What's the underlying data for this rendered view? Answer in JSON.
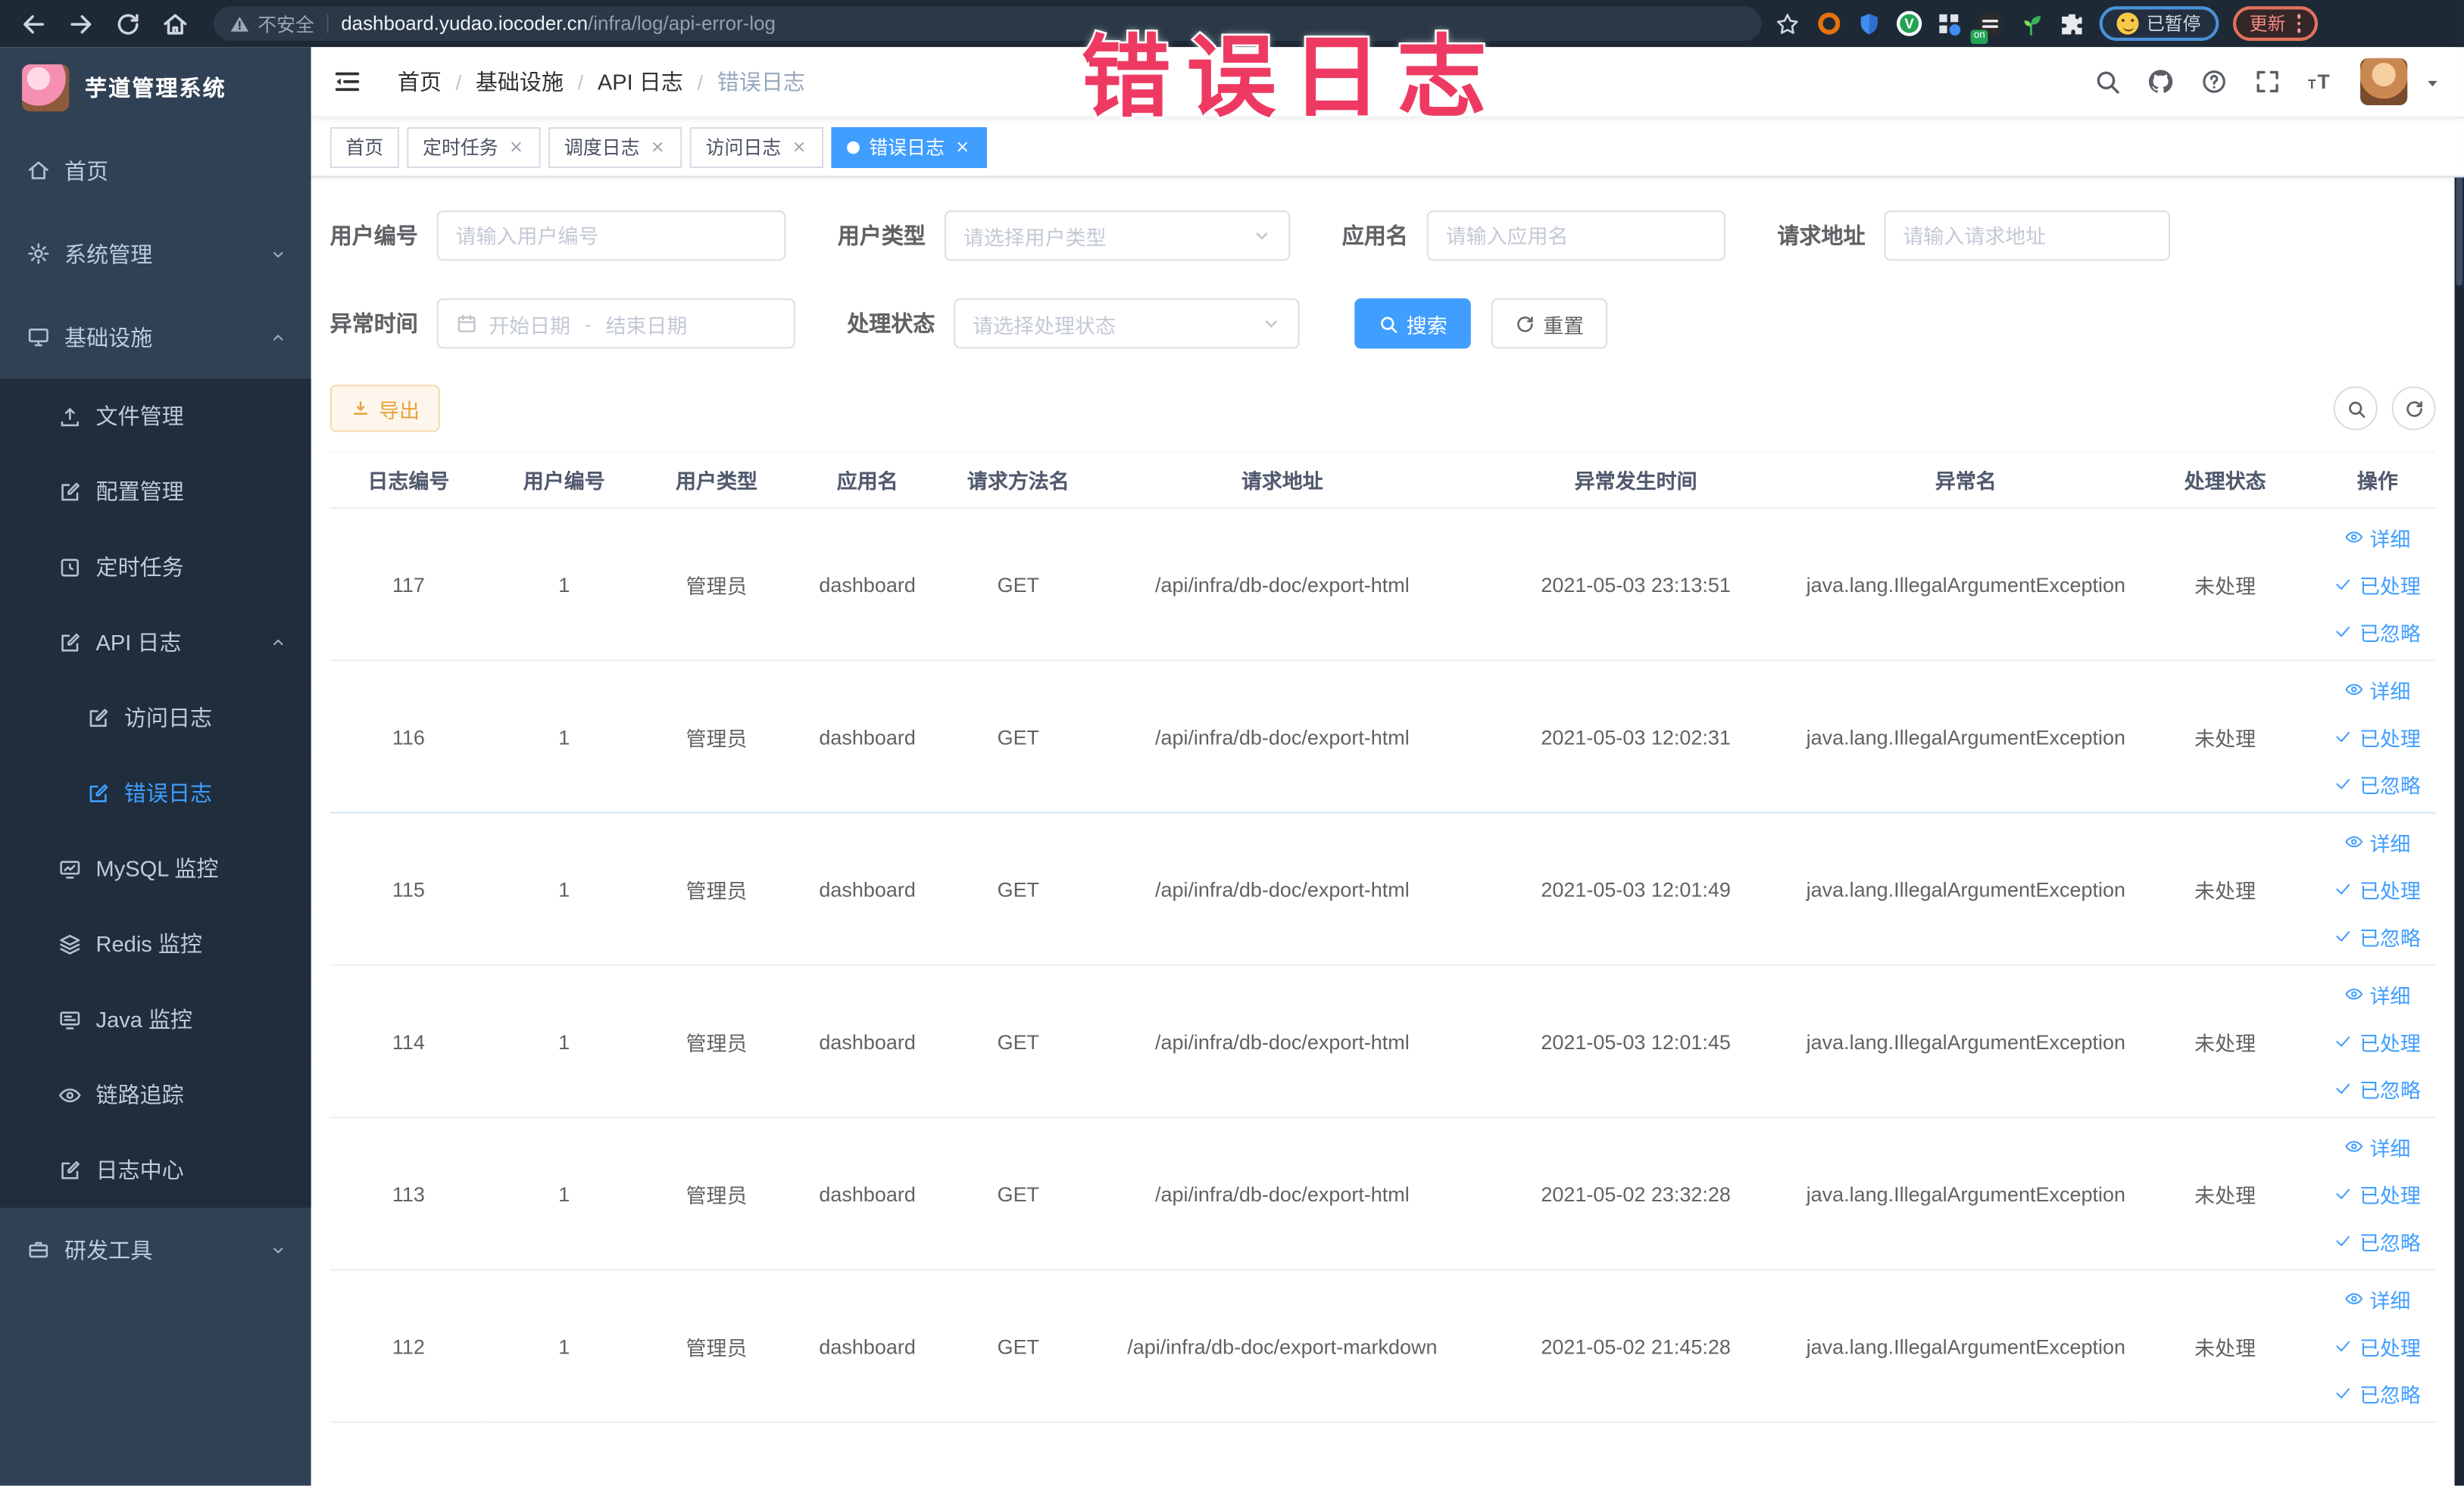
{
  "colors": {
    "accent": "#409eff",
    "overlay_pink": "#ee3a62",
    "sidebar_bg": "#304156",
    "submenu_bg": "#1f2d3d",
    "chrome_bg": "#1e2936",
    "warning_btn": "#e6a23c"
  },
  "browser": {
    "security_label": "不安全",
    "url_host": "dashboard.yudao.iocoder.cn",
    "url_path": "/infra/log/api-error-log",
    "paused_pill": "已暂停",
    "update_pill": "更新",
    "extension_badge": "on"
  },
  "overlay_title": "错误日志",
  "app_header": {
    "logo_title": "芋道管理系统",
    "breadcrumb": [
      "首页",
      "基础设施",
      "API 日志",
      "错误日志"
    ]
  },
  "tags": [
    {
      "key": "home",
      "label": "首页",
      "closable": false,
      "active": false
    },
    {
      "key": "scheduled-job",
      "label": "定时任务",
      "closable": true,
      "active": false
    },
    {
      "key": "job-log",
      "label": "调度日志",
      "closable": true,
      "active": false
    },
    {
      "key": "access-log",
      "label": "访问日志",
      "closable": true,
      "active": false
    },
    {
      "key": "error-log",
      "label": "错误日志",
      "closable": true,
      "active": true
    }
  ],
  "sidebar": {
    "items": [
      {
        "key": "home",
        "label": "首页",
        "icon": "home-icon",
        "level": 1,
        "sub": false
      },
      {
        "key": "system-management",
        "label": "系统管理",
        "icon": "gear-icon",
        "level": 1,
        "sub": false,
        "arrow": "down"
      },
      {
        "key": "infrastructure",
        "label": "基础设施",
        "icon": "monitor-icon",
        "level": 1,
        "sub": false,
        "arrow": "up"
      },
      {
        "key": "file-management",
        "label": "文件管理",
        "icon": "upload-icon",
        "level": 2,
        "sub": true
      },
      {
        "key": "config-management",
        "label": "配置管理",
        "icon": "edit-icon",
        "level": 2,
        "sub": true
      },
      {
        "key": "scheduled-job",
        "label": "定时任务",
        "icon": "clock-icon",
        "level": 2,
        "sub": true
      },
      {
        "key": "api-log",
        "label": "API 日志",
        "icon": "edit-icon",
        "level": 2,
        "sub": true,
        "arrow": "up"
      },
      {
        "key": "access-log",
        "label": "访问日志",
        "icon": "edit-icon",
        "level": 3,
        "sub": true
      },
      {
        "key": "error-log",
        "label": "错误日志",
        "icon": "edit-icon",
        "level": 3,
        "sub": true,
        "active": true
      },
      {
        "key": "mysql-monitor",
        "label": "MySQL 监控",
        "icon": "chart-icon",
        "level": 2,
        "sub": true
      },
      {
        "key": "redis-monitor",
        "label": "Redis 监控",
        "icon": "layers-icon",
        "level": 2,
        "sub": true
      },
      {
        "key": "java-monitor",
        "label": "Java 监控",
        "icon": "screen-icon",
        "level": 2,
        "sub": true
      },
      {
        "key": "trace",
        "label": "链路追踪",
        "icon": "eye-icon",
        "level": 2,
        "sub": true
      },
      {
        "key": "log-center",
        "label": "日志中心",
        "icon": "edit-icon",
        "level": 2,
        "sub": true
      },
      {
        "key": "dev-tools",
        "label": "研发工具",
        "icon": "briefcase-icon",
        "level": 1,
        "sub": false,
        "arrow": "down"
      }
    ]
  },
  "filters": {
    "user_id": {
      "label": "用户编号",
      "placeholder": "请输入用户编号"
    },
    "user_type": {
      "label": "用户类型",
      "placeholder": "请选择用户类型"
    },
    "app_name": {
      "label": "应用名",
      "placeholder": "请输入应用名"
    },
    "request_url": {
      "label": "请求地址",
      "placeholder": "请输入请求地址"
    },
    "exception_time": {
      "label": "异常时间",
      "start_placeholder": "开始日期",
      "separator": "-",
      "end_placeholder": "结束日期"
    },
    "process_status": {
      "label": "处理状态",
      "placeholder": "请选择处理状态"
    },
    "search_label": "搜索",
    "reset_label": "重置"
  },
  "toolbar": {
    "export_label": "导出"
  },
  "table": {
    "columns": [
      {
        "label": "日志编号",
        "key": "id"
      },
      {
        "label": "用户编号",
        "key": "user_id"
      },
      {
        "label": "用户类型",
        "key": "user_type"
      },
      {
        "label": "应用名",
        "key": "app"
      },
      {
        "label": "请求方法名",
        "key": "method"
      },
      {
        "label": "请求地址",
        "key": "url"
      },
      {
        "label": "异常发生时间",
        "key": "time"
      },
      {
        "label": "异常名",
        "key": "exception"
      },
      {
        "label": "处理状态",
        "key": "status"
      },
      {
        "label": "操作",
        "key": "actions"
      }
    ],
    "actions": [
      {
        "key": "detail",
        "label": "详细",
        "icon": "eye-icon"
      },
      {
        "key": "processed",
        "label": "已处理",
        "icon": "check-icon"
      },
      {
        "key": "ignored",
        "label": "已忽略",
        "icon": "check-icon"
      }
    ],
    "rows": [
      {
        "id": "117",
        "user_id": "1",
        "user_type": "管理员",
        "app": "dashboard",
        "method": "GET",
        "url": "/api/infra/db-doc/export-html",
        "time": "2021-05-03 23:13:51",
        "exception": "java.lang.IllegalArgumentException",
        "status": "未处理"
      },
      {
        "id": "116",
        "user_id": "1",
        "user_type": "管理员",
        "app": "dashboard",
        "method": "GET",
        "url": "/api/infra/db-doc/export-html",
        "time": "2021-05-03 12:02:31",
        "exception": "java.lang.IllegalArgumentException",
        "status": "未处理"
      },
      {
        "id": "115",
        "user_id": "1",
        "user_type": "管理员",
        "app": "dashboard",
        "method": "GET",
        "url": "/api/infra/db-doc/export-html",
        "time": "2021-05-03 12:01:49",
        "exception": "java.lang.IllegalArgumentException",
        "status": "未处理"
      },
      {
        "id": "114",
        "user_id": "1",
        "user_type": "管理员",
        "app": "dashboard",
        "method": "GET",
        "url": "/api/infra/db-doc/export-html",
        "time": "2021-05-03 12:01:45",
        "exception": "java.lang.IllegalArgumentException",
        "status": "未处理"
      },
      {
        "id": "113",
        "user_id": "1",
        "user_type": "管理员",
        "app": "dashboard",
        "method": "GET",
        "url": "/api/infra/db-doc/export-html",
        "time": "2021-05-02 23:32:28",
        "exception": "java.lang.IllegalArgumentException",
        "status": "未处理"
      },
      {
        "id": "112",
        "user_id": "1",
        "user_type": "管理员",
        "app": "dashboard",
        "method": "GET",
        "url": "/api/infra/db-doc/export-markdown",
        "time": "2021-05-02 21:45:28",
        "exception": "java.lang.IllegalArgumentException",
        "status": "未处理"
      }
    ]
  }
}
